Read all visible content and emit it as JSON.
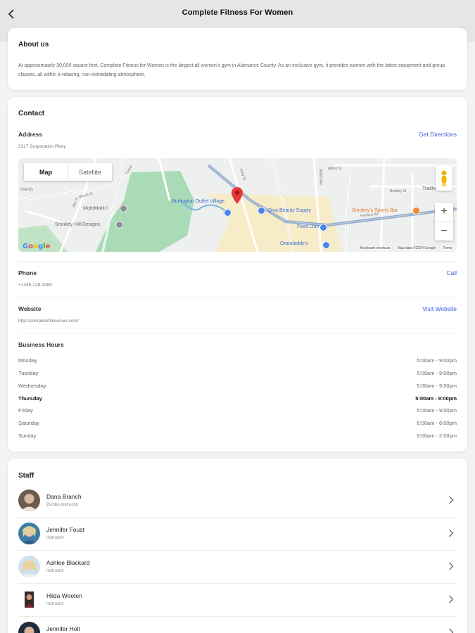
{
  "header": {
    "title": "Complete Fitness For Women",
    "back_icon": "chevron-left-icon"
  },
  "about": {
    "title": "About us",
    "text": "At approximately 30,000 square feet, Complete Fitness for Women is the largest all women's gym in Alamance County. As an exclusive gym, it provides women with the latest equipment and group classes, all within a relaxing, non-intimidating atmosphere."
  },
  "contact": {
    "title": "Contact",
    "address_label": "Address",
    "address_value": "2317 Corporation Pkwy",
    "directions_link": "Get Directions",
    "phone_label": "Phone",
    "phone_value": "+1336-228-0080",
    "call_link": "Call",
    "website_label": "Website",
    "website_value": "http://completefitnesswo.com/",
    "website_link": "Visit Website",
    "hours_label": "Business Hours",
    "hours": [
      {
        "day": "Monday",
        "time": "5:00am - 9:00pm"
      },
      {
        "day": "Tuesday",
        "time": "5:00am - 9:00pm"
      },
      {
        "day": "Wednesday",
        "time": "5:00am - 9:00pm"
      },
      {
        "day": "Thursday",
        "time": "5:00am - 9:00pm"
      },
      {
        "day": "Friday",
        "time": "5:00am - 9:00pm"
      },
      {
        "day": "Saturday",
        "time": "6:00am - 6:00pm"
      },
      {
        "day": "Sunday",
        "time": "9:00am - 2:00pm"
      }
    ],
    "today": "Thursday"
  },
  "map": {
    "map_label": "Map",
    "satellite_label": "Satellite",
    "zoom_in": "+",
    "zoom_out": "−",
    "google": "Google",
    "keyboard": "Keyboard shortcuts",
    "map_data": "Map data ©2024 Google",
    "terms": "Terms",
    "places": {
      "outlet": "Burlington Outlet Village",
      "diva": "Diva Beauty Supply",
      "smokeys": "Smokey's Sports Bar",
      "food_lion": "Food Lion",
      "grandaddys": "Grandaddy's",
      "motomark": "MotoMark I",
      "smokey_hill": "Smokey Hill Designs",
      "trailhead": "Trailhead C"
    },
    "streets": {
      "s1": "Tucker",
      "s2": "Maple Ave",
      "s3": "Hanford Rd",
      "s4": "Bradley St",
      "s5": "Albert St",
      "s6": "Holly St",
      "s7": "Morris St",
      "s8": "Alto St",
      "s9": "tments"
    },
    "colors": {
      "park": "#a9dbb7",
      "commercial": "#f7ecc8",
      "highway": "#8ea7c9",
      "water": "#77b7e8"
    }
  },
  "staff": {
    "title": "Staff",
    "members": [
      {
        "name": "Dana Branch",
        "role": "Zumba Instructor"
      },
      {
        "name": "Jennifer Foust",
        "role": "Instructor"
      },
      {
        "name": "Ashlee Blackard",
        "role": "Instructor"
      },
      {
        "name": "Hilda Wooten",
        "role": "Instructor"
      },
      {
        "name": "Jennifer Holt",
        "role": ""
      }
    ]
  },
  "colors": {
    "accent": "#3a5bd9",
    "pin": "#e53935"
  }
}
